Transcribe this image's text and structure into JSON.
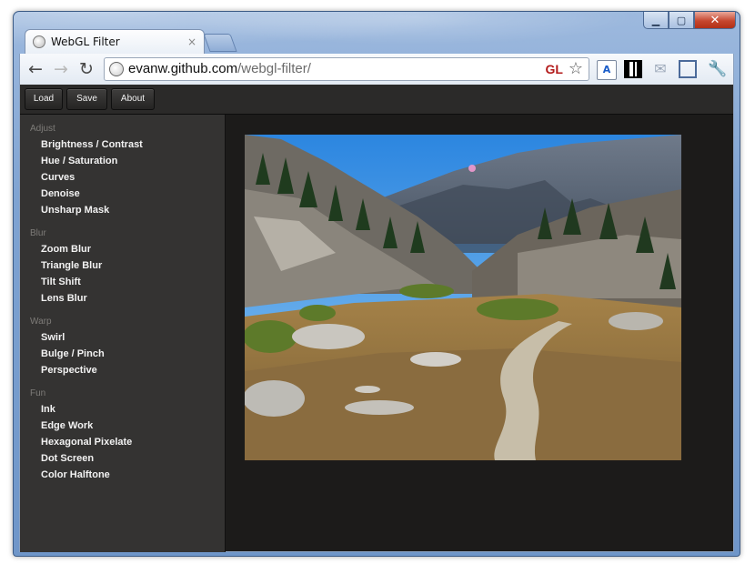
{
  "window": {
    "minimize_icon": "minimize-icon",
    "maximize_icon": "maximize-icon",
    "close_icon": "close-icon"
  },
  "tab": {
    "title": "WebGL Filter",
    "close_glyph": "×"
  },
  "toolbar": {
    "back_glyph": "←",
    "forward_glyph": "→",
    "reload_glyph": "↻",
    "url_host": "evanw.github.com",
    "url_path": "/webgl-filter/",
    "gl_badge": "GL",
    "star_glyph": "☆"
  },
  "menu": {
    "load": "Load",
    "save": "Save",
    "about": "About"
  },
  "sidebar": {
    "groups": [
      {
        "title": "Adjust",
        "items": [
          "Brightness / Contrast",
          "Hue / Saturation",
          "Curves",
          "Denoise",
          "Unsharp Mask"
        ]
      },
      {
        "title": "Blur",
        "items": [
          "Zoom Blur",
          "Triangle Blur",
          "Tilt Shift",
          "Lens Blur"
        ]
      },
      {
        "title": "Warp",
        "items": [
          "Swirl",
          "Bulge / Pinch",
          "Perspective"
        ]
      },
      {
        "title": "Fun",
        "items": [
          "Ink",
          "Edge Work",
          "Hexagonal Pixelate",
          "Dot Screen",
          "Color Halftone"
        ]
      }
    ]
  },
  "colors": {
    "page_bg": "#1c1b1a",
    "sidebar_bg": "#343332",
    "group_title": "#7e7c79",
    "item_text": "#f2f2f2"
  }
}
